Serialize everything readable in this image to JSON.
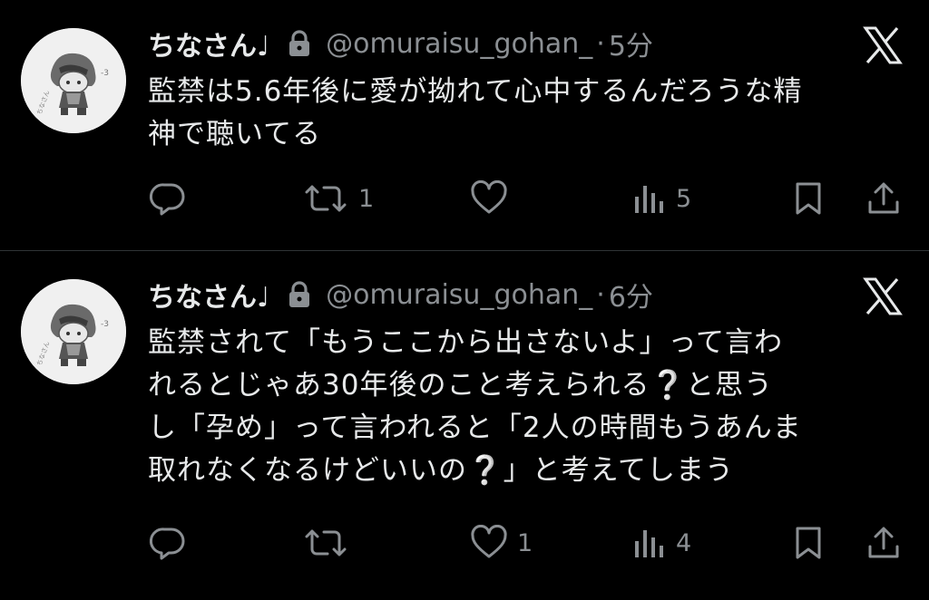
{
  "colors": {
    "background": "#000000",
    "text": "#e7e9ea",
    "secondary_text": "#8b8f93",
    "divider": "#2f3336"
  },
  "tweets": [
    {
      "display_name": "ちなさん♩",
      "handle": "@omuraisu_gohan_",
      "separator": "·",
      "time": "5分",
      "text_lines": [
        "監禁は5.6年後に愛が拗れて心中するんだろうな精",
        "神で聴いてる"
      ],
      "icons": [
        "avatar",
        "lock-icon",
        "x-logo-icon",
        "reply-icon",
        "retweet-icon",
        "like-icon",
        "views-icon",
        "bookmark-icon",
        "share-icon"
      ],
      "actions": {
        "reply": "",
        "retweet": "1",
        "like": "",
        "views": "5"
      }
    },
    {
      "display_name": "ちなさん♩",
      "handle": "@omuraisu_gohan_",
      "separator": "·",
      "time": "6分",
      "text_lines": [
        "監禁されて「もうここから出さないよ」って言わ",
        "れるとじゃあ30年後のこと考えられる❔と思う",
        "し「孕め」って言われると「2人の時間もうあんま",
        "取れなくなるけどいいの❔」と考えてしまう"
      ],
      "icons": [
        "avatar",
        "lock-icon",
        "x-logo-icon",
        "reply-icon",
        "retweet-icon",
        "like-icon",
        "views-icon",
        "bookmark-icon",
        "share-icon"
      ],
      "actions": {
        "reply": "",
        "retweet": "",
        "like": "1",
        "views": "4"
      }
    }
  ]
}
